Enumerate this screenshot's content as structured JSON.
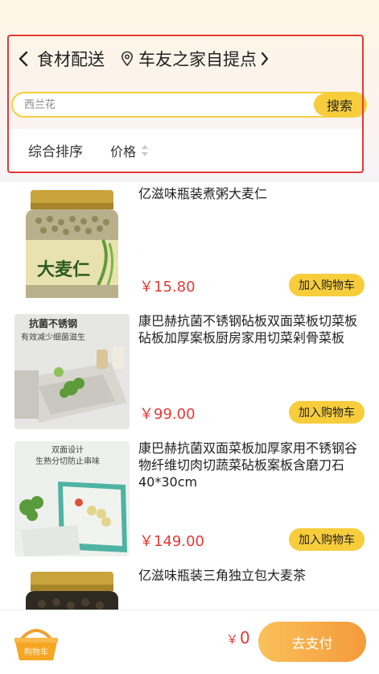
{
  "header": {
    "title": "食材配送",
    "store": "车友之家自提点",
    "back_icon": "chevron-left-icon",
    "location_icon": "location-pin-icon",
    "store_chevron_icon": "chevron-right-icon"
  },
  "search": {
    "placeholder": "西兰花",
    "button_label": "搜索"
  },
  "sort": {
    "default_label": "综合排序",
    "price_label": "价格"
  },
  "products": [
    {
      "name": "亿滋味瓶装煮粥大麦仁",
      "price": "￥15.80",
      "cart_label": "加入购物车"
    },
    {
      "name": "康巴赫抗菌不锈钢砧板双面菜板切菜板砧板加厚案板厨房家用切菜剁骨菜板",
      "price": "￥99.00",
      "cart_label": "加入购物车"
    },
    {
      "name": "康巴赫抗菌双面菜板加厚家用不锈钢谷物纤维切肉切蔬菜砧板案板含磨刀石40*30cm",
      "price": "￥149.00",
      "cart_label": "加入购物车"
    },
    {
      "name": "亿滋味瓶装三角独立包大麦茶",
      "price": "",
      "cart_label": ""
    }
  ],
  "thumb_texts": {
    "jar_label": "大麦仁",
    "board1_title": "抗菌不锈钢",
    "board1_sub": "有效减少细菌滋生",
    "board2_title": "双面设计",
    "board2_sub": "生熟分切防止串味"
  },
  "footer": {
    "basket_label": "购物车",
    "currency": "￥",
    "total": "0",
    "pay_label": "去支付"
  },
  "colors": {
    "accent_yellow": "#f7cd3c",
    "price_red": "#e53935",
    "pay_orange": "#f59a3b",
    "highlight_border": "#e53935"
  }
}
